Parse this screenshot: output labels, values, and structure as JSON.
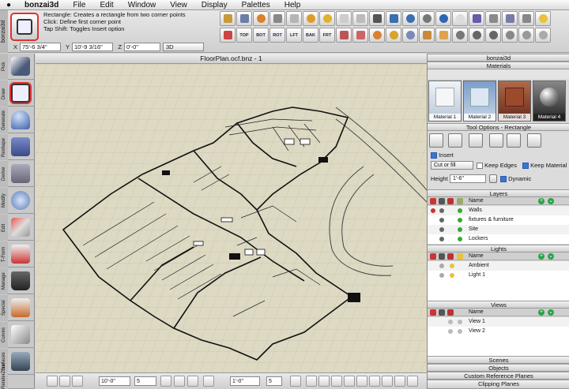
{
  "menubar": {
    "app": "bonzai3d",
    "items": [
      "File",
      "Edit",
      "Window",
      "View",
      "Display",
      "Palettes",
      "Help"
    ]
  },
  "app_tab": "bonzai3d",
  "tool_help": {
    "line1": "Rectangle:  Creates a rectangle from two corner points",
    "line2": "Click: Define first corner point",
    "line3": "Tap Shift: Toggles Insert option"
  },
  "coords": {
    "x_label": "X",
    "x_value": "75'-6 3/4\"",
    "y_label": "Y",
    "y_value": "10'-9 3/16\"",
    "z_label": "Z",
    "z_value": "0'-0\"",
    "mode": "3D"
  },
  "view_buttons": [
    "TOP",
    "BOT",
    "ROT",
    "LFT",
    "BAK",
    "FRT"
  ],
  "left_tools": [
    "Pick",
    "Draw",
    "Generate",
    "Reshape",
    "Derive",
    "Modify",
    "Edit",
    "T-Form",
    "Manage",
    "Special",
    "Curves",
    "Surfaces",
    "RenderZone"
  ],
  "document": {
    "title": "FloorPlan.ocf.bnz - 1"
  },
  "bottombar": {
    "length_value": "10'-0\"",
    "count_value": "5",
    "snap_value": "1'-0\"",
    "snap_count": "5"
  },
  "right_panel": {
    "title": "bonzai3d",
    "materials_title": "Materials",
    "materials": [
      {
        "label": "Material 1",
        "color": "#dfe6ee",
        "selected": false
      },
      {
        "label": "Material 2",
        "color": "#9ab4d4",
        "selected": false
      },
      {
        "label": "Material 3",
        "color": "#9b4a2c",
        "selected": false
      },
      {
        "label": "Material 4",
        "color": "#5a5a5a",
        "selected": true
      }
    ],
    "tool_options_title": "Tool Options - Rectangle",
    "insert_label": "Insert",
    "cut_or_fill": "Cut or fill",
    "keep_edges": "Keep Edges",
    "keep_material": "Keep Material",
    "height_label": "Height",
    "height_value": "1'-6\"",
    "dynamic_label": "Dynamic",
    "layers_title": "Layers",
    "layers_header": "Name",
    "layers": [
      "Walls",
      "fixtures & furniture",
      "Site",
      "Lockers"
    ],
    "lights_title": "Lights",
    "lights_header": "Name",
    "lights": [
      "Ambient",
      "Light 1"
    ],
    "views_title": "Views",
    "views_header": "Name",
    "views": [
      "View 1",
      "View 2"
    ],
    "scenes_title": "Scenes",
    "objects_title": "Objects",
    "custom_ref_title": "Custom Reference Planes",
    "clipping_title": "Clipping Planes"
  }
}
